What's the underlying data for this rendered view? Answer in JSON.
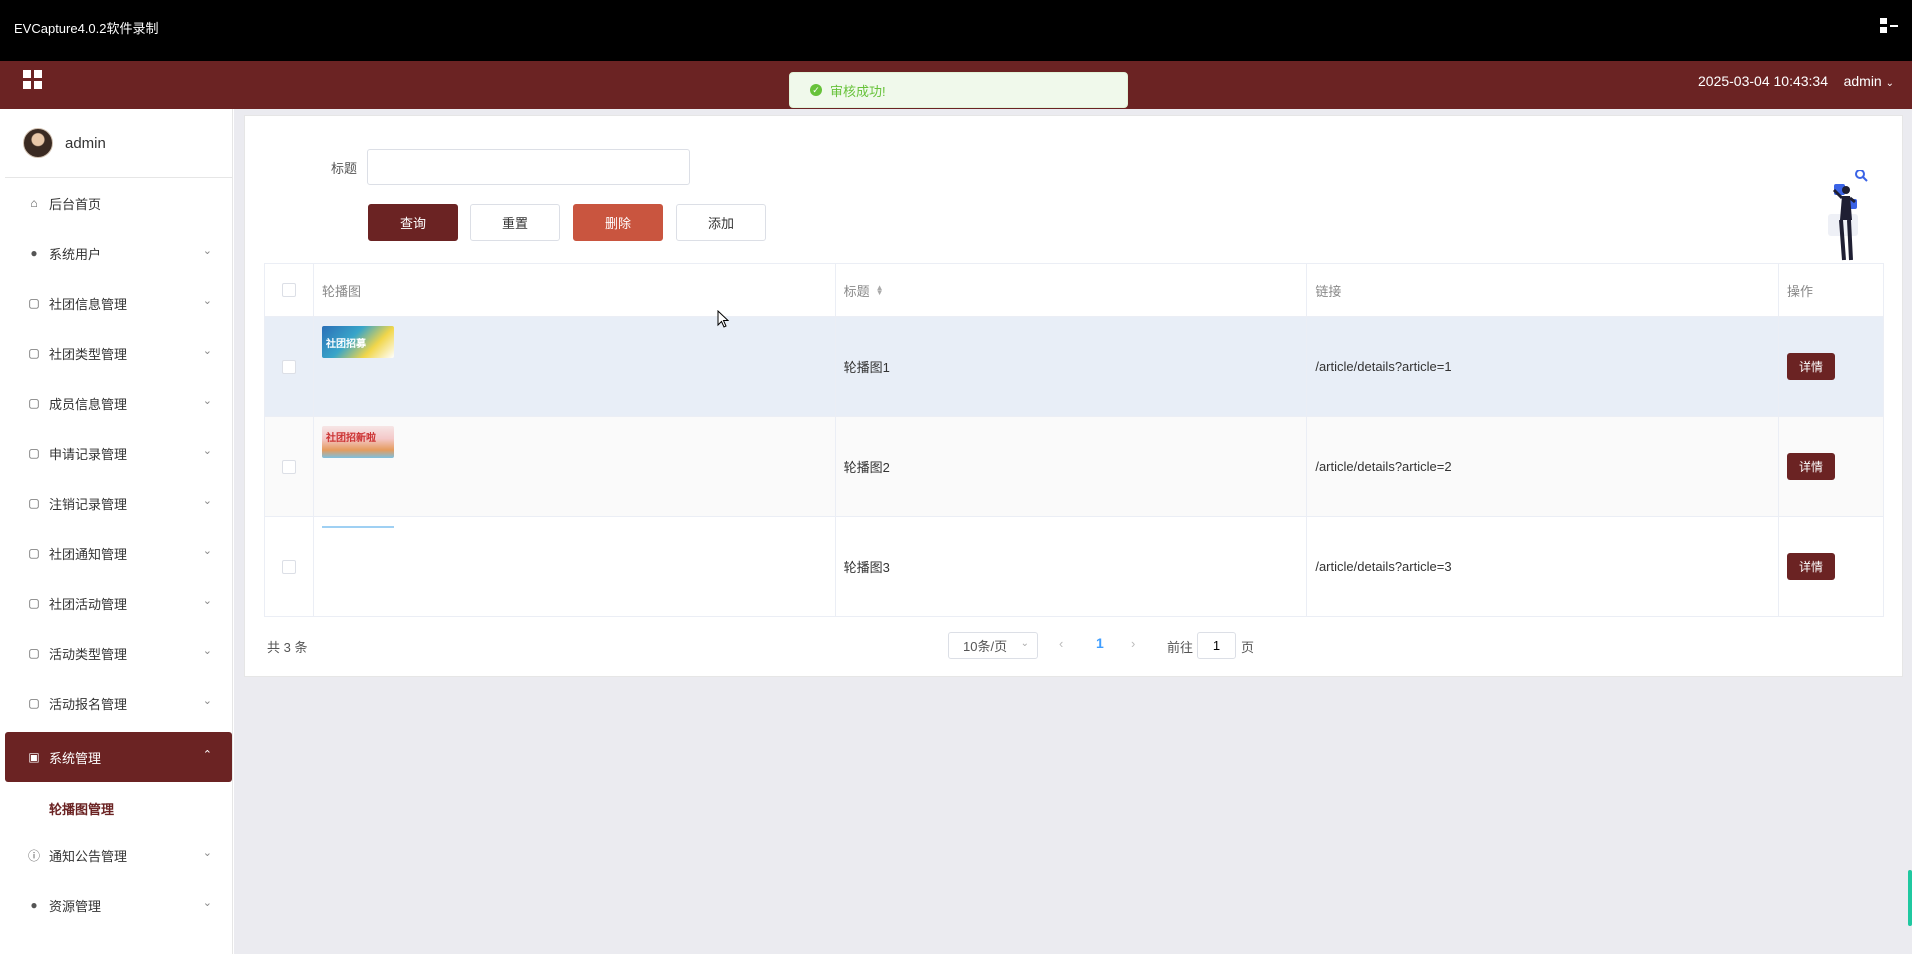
{
  "window": {
    "title": "EVCapture4.0.2软件录制"
  },
  "header": {
    "datetime": "2025-03-04 10:43:34",
    "user": "admin"
  },
  "toast": {
    "message": "审核成功!"
  },
  "sidebar": {
    "profile_name": "admin",
    "items": [
      {
        "label": "后台首页",
        "icon": "home-icon"
      },
      {
        "label": "系统用户",
        "icon": "user-icon"
      },
      {
        "label": "社团信息管理",
        "icon": "doc-icon"
      },
      {
        "label": "社团类型管理",
        "icon": "doc-icon"
      },
      {
        "label": "成员信息管理",
        "icon": "doc-icon"
      },
      {
        "label": "申请记录管理",
        "icon": "doc-icon"
      },
      {
        "label": "注销记录管理",
        "icon": "doc-icon"
      },
      {
        "label": "社团通知管理",
        "icon": "doc-icon"
      },
      {
        "label": "社团活动管理",
        "icon": "doc-icon"
      },
      {
        "label": "活动类型管理",
        "icon": "doc-icon"
      },
      {
        "label": "活动报名管理",
        "icon": "doc-icon"
      },
      {
        "label": "系统管理",
        "icon": "picture-icon",
        "active": true
      },
      {
        "label": "轮播图管理",
        "sub": true
      },
      {
        "label": "通知公告管理",
        "icon": "info-icon"
      },
      {
        "label": "资源管理",
        "icon": "location-icon"
      }
    ]
  },
  "search": {
    "label": "标题",
    "value": "",
    "placeholder": ""
  },
  "buttons": {
    "query": "查询",
    "reset": "重置",
    "delete": "删除",
    "add": "添加"
  },
  "table": {
    "headers": {
      "image": "轮播图",
      "title": "标题",
      "link": "链接",
      "action": "操作"
    },
    "rows": [
      {
        "image_text": "社团招募",
        "title": "轮播图1",
        "link": "/article/details?article=1",
        "action": "详情"
      },
      {
        "image_text": "社团招新啦",
        "title": "轮播图2",
        "link": "/article/details?article=2",
        "action": "详情"
      },
      {
        "image_text": "",
        "title": "轮播图3",
        "link": "/article/details?article=3",
        "action": "详情"
      }
    ]
  },
  "pagination": {
    "total": "共 3 条",
    "page_size": "10条/页",
    "current_page": "1",
    "goto_label": "前往",
    "goto_value": "1",
    "goto_suffix": "页"
  },
  "colors": {
    "brand": "#6b2323",
    "danger": "#c9553f",
    "success": "#67c23a",
    "link": "#409eff"
  }
}
